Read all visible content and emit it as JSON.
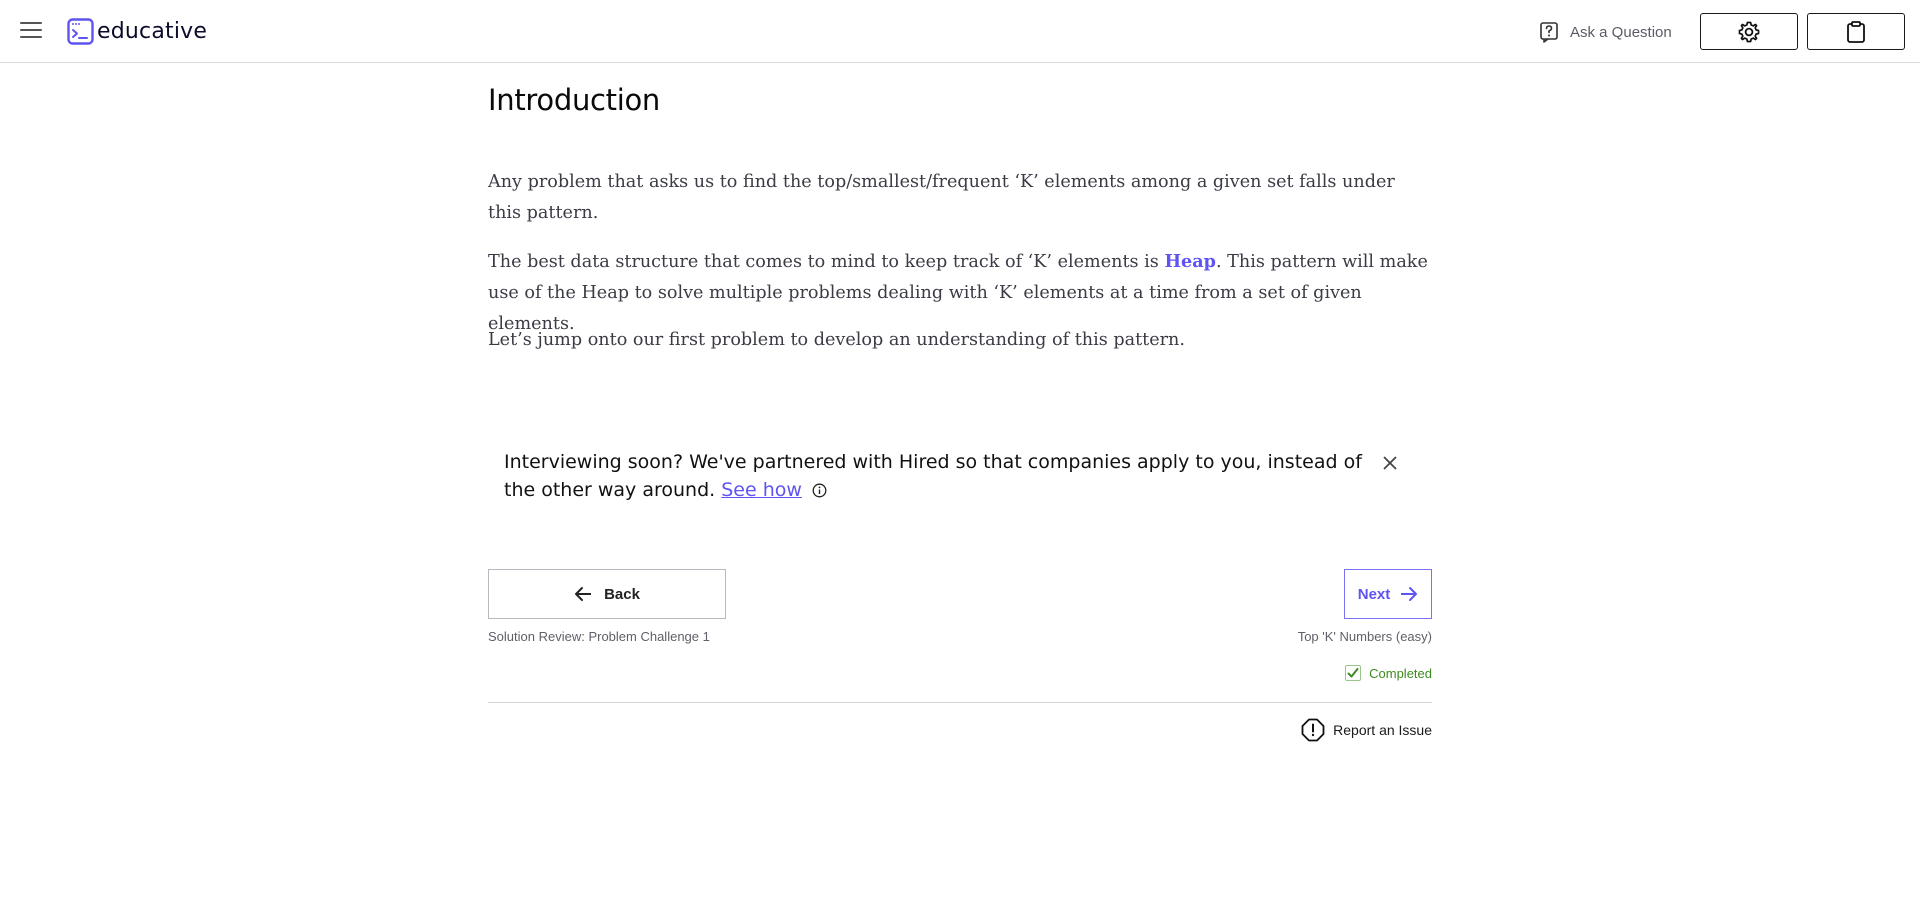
{
  "header": {
    "brand": "educative",
    "ask_label": "Ask a Question"
  },
  "lesson": {
    "title": "Introduction",
    "p1": "Any problem that asks us to find the top/smallest/frequent ‘K’ elements among a given set falls under this pattern.",
    "p2_before": "The best data structure that comes to mind to keep track of ‘K’ elements is ",
    "p2_highlight": "Heap",
    "p2_after": ". This pattern will make use of the Heap to solve multiple problems dealing with ‘K’ elements at a time from a set of given elements.",
    "p3": "Let’s jump onto our first problem to develop an understanding of this pattern."
  },
  "banner": {
    "text": "Interviewing soon? We've partnered with Hired so that companies apply to you, instead of the other way around.",
    "link_label": "See how"
  },
  "nav": {
    "back_label": "Back",
    "back_subtitle": "Solution Review: Problem Challenge 1",
    "next_label": "Next",
    "next_subtitle": "Top 'K' Numbers (easy)",
    "completed_label": "Completed",
    "report_label": "Report an Issue"
  },
  "colors": {
    "accent": "#5f54f2",
    "completed": "#3d8b1f"
  },
  "icons": [
    "menu-icon",
    "educative-logo-icon",
    "question-icon",
    "gear-icon",
    "clipboard-icon",
    "info-icon",
    "close-icon",
    "arrow-left-icon",
    "arrow-right-icon",
    "check-icon",
    "alert-icon"
  ]
}
